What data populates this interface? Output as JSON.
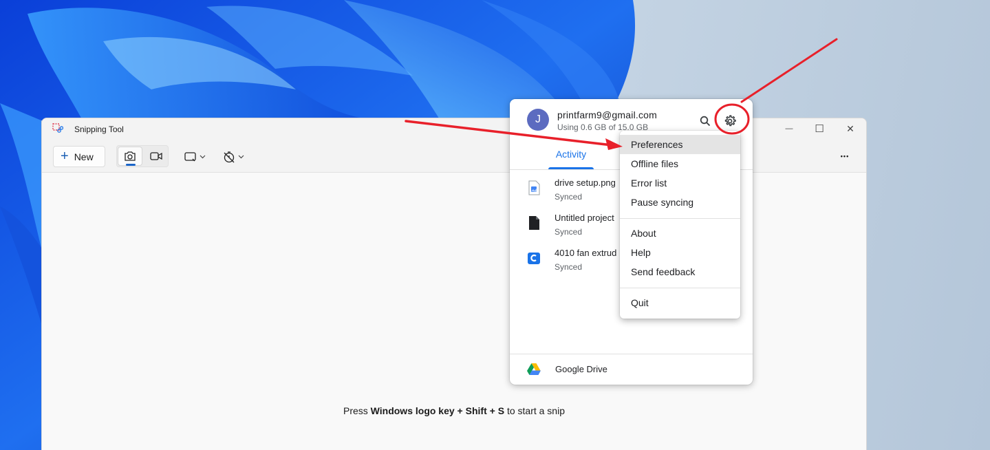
{
  "snipping_tool": {
    "title": "Snipping Tool",
    "new_label": "New",
    "hint_prefix": "Press ",
    "hint_key1": "Windows logo key",
    "hint_plus1": " + ",
    "hint_key2": "Shift",
    "hint_plus2": " + ",
    "hint_key3": "S",
    "hint_suffix": " to start a snip",
    "minimize_glyph": "—",
    "maximize_glyph": "☐",
    "close_glyph": "✕",
    "more_glyph": "•••",
    "icons": [
      "snipping-tool-icon",
      "camera-icon",
      "video-icon",
      "rectangle-mode-icon",
      "timer-off-icon",
      "chevron-down-icon"
    ]
  },
  "drive": {
    "avatar_letter": "J",
    "email": "printfarm9@gmail.com",
    "storage": "Using 0.6 GB of 15.0 GB",
    "tab_activity": "Activity",
    "files": [
      {
        "name": "drive setup.png",
        "status": "Synced",
        "icon": "image-file-icon"
      },
      {
        "name": "Untitled project",
        "status": "Synced",
        "icon": "document-file-icon"
      },
      {
        "name": "4010 fan extrud",
        "status": "Synced",
        "icon": "cad-file-icon"
      }
    ],
    "footer_label": "Google Drive",
    "colors": {
      "accent": "#1a73e8",
      "avatar": "#5c6bc0",
      "annotation": "#e8202a"
    }
  },
  "menu": {
    "items": [
      "Preferences",
      "Offline files",
      "Error list",
      "Pause syncing",
      "About",
      "Help",
      "Send feedback",
      "Quit"
    ]
  }
}
